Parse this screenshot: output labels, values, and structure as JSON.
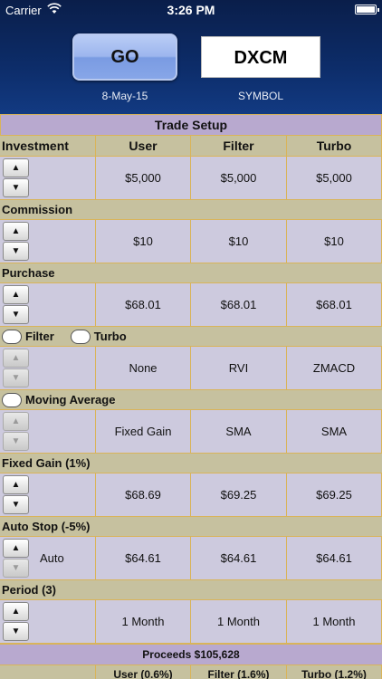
{
  "status_bar": {
    "carrier": "Carrier",
    "wifi_icon": "wifi-icon",
    "time": "3:26 PM",
    "battery_icon": "battery-icon"
  },
  "header": {
    "go_label": "GO",
    "symbol_value": "DXCM",
    "date": "8-May-15",
    "symbol_label": "SYMBOL"
  },
  "colors": {
    "header_bg": "#0d2d6a",
    "title_bg": "#b8a9cf",
    "section_bg": "#c6c19f",
    "cell_bg": "#cdcade",
    "border": "#d9b45a"
  },
  "table": {
    "title": "Trade Setup",
    "columns": [
      "Investment",
      "User",
      "Filter",
      "Turbo"
    ],
    "sections": {
      "commission": "Commission",
      "purchase": "Purchase",
      "filter_check": "Filter",
      "turbo_check": "Turbo",
      "moving_average_check": "Moving Average",
      "fixed_gain": "Fixed Gain (1%)",
      "auto_stop": "Auto Stop (-5%)",
      "period": "Period (3)"
    },
    "rows": {
      "investment": [
        "$5,000",
        "$5,000",
        "$5,000"
      ],
      "commission": [
        "$10",
        "$10",
        "$10"
      ],
      "purchase": [
        "$68.01",
        "$68.01",
        "$68.01"
      ],
      "filter": [
        "None",
        "RVI",
        "ZMACD"
      ],
      "moving_average": [
        "Fixed Gain",
        "SMA",
        "SMA"
      ],
      "fixed_gain": [
        "$68.69",
        "$69.25",
        "$69.25"
      ],
      "auto_stop": [
        "$64.61",
        "$64.61",
        "$64.61"
      ],
      "auto_stop_mode": "Auto",
      "period": [
        "1 Month",
        "1 Month",
        "1 Month"
      ]
    },
    "stepper": {
      "up": "▲",
      "down": "▼"
    },
    "proceeds": "Proceeds $105,628",
    "bottom_headers": [
      "User (0.6%)",
      "Filter (1.6%)",
      "Turbo (1.2%)"
    ]
  }
}
